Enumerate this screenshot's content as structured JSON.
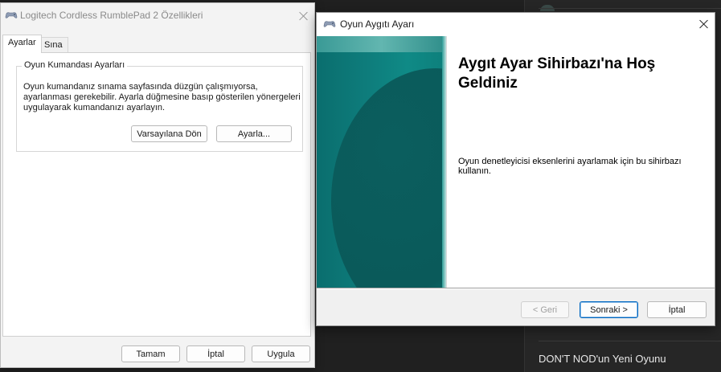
{
  "background": {
    "news_headline": "DON'T NOD'un Yeni Oyunu"
  },
  "properties_window": {
    "title": "Logitech Cordless RumblePad 2 Özellikleri",
    "tabs": [
      {
        "label": "Ayarlar",
        "active": true
      },
      {
        "label": "Sına",
        "active": false
      }
    ],
    "group_title": "Oyun Kumandası Ayarları",
    "group_description": "Oyun kumandanız sınama sayfasında düzgün çalışmıyorsa, ayarlanması gerekebilir. Ayarla düğmesine basıp gösterilen yönergeleri uygulayarak kumandanızı ayarlayın.",
    "reset_button": "Varsayılana Dön",
    "adjust_button": "Ayarla...",
    "ok_button": "Tamam",
    "cancel_button": "İptal",
    "apply_button": "Uygula"
  },
  "wizard_window": {
    "title": "Oyun Aygıtı Ayarı",
    "heading": "Aygıt Ayar Sihirbazı'na Hoş Geldiniz",
    "description": "Oyun denetleyicisi eksenlerini ayarlamak için bu sihirbazı kullanın.",
    "back_button": "< Geri",
    "next_button": "Sonraki >",
    "cancel_button": "İptal"
  },
  "colors": {
    "banner_teal": "#0e7d7c",
    "accent_blue": "#0067c0"
  },
  "icons": [
    "gamepad-icon",
    "close-icon"
  ]
}
